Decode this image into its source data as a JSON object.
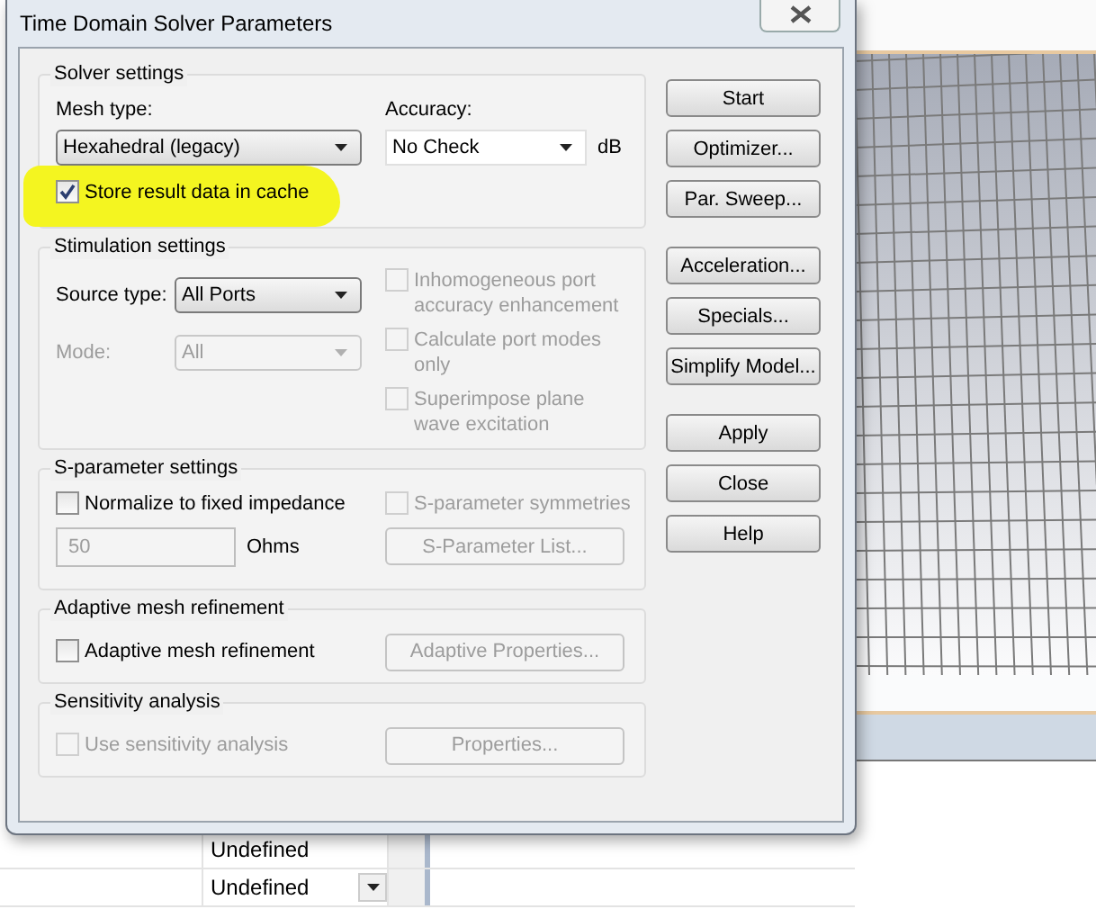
{
  "window": {
    "title": "Time Domain Solver Parameters"
  },
  "solver_settings": {
    "title": "Solver settings",
    "mesh_type": {
      "label": "Mesh type:",
      "value": "Hexahedral (legacy)"
    },
    "accuracy": {
      "label": "Accuracy:",
      "value": "No Check",
      "unit": "dB"
    },
    "store_cache": {
      "label": "Store result data in cache",
      "checked": true,
      "disabled": false
    }
  },
  "stimulation_settings": {
    "title": "Stimulation settings",
    "source_type": {
      "label": "Source type:",
      "value": "All Ports",
      "disabled": false
    },
    "mode": {
      "label": "Mode:",
      "value": "All",
      "disabled": true
    },
    "options": [
      {
        "label": "Inhomogeneous port accuracy enhancement",
        "checked": false,
        "disabled": true
      },
      {
        "label": "Calculate port modes only",
        "checked": false,
        "disabled": true
      },
      {
        "label": "Superimpose plane wave excitation",
        "checked": false,
        "disabled": true
      }
    ]
  },
  "s_parameter_settings": {
    "title": "S-parameter settings",
    "normalize": {
      "label": "Normalize to fixed impedance",
      "checked": false,
      "disabled": false
    },
    "symmetries": {
      "label": "S-parameter symmetries",
      "checked": false,
      "disabled": true
    },
    "impedance": {
      "value": "50",
      "unit": "Ohms",
      "disabled": true
    },
    "list_button": {
      "label": "S-Parameter List...",
      "disabled": true
    }
  },
  "adaptive_mesh_refinement": {
    "title": "Adaptive mesh refinement",
    "checkbox": {
      "label": "Adaptive mesh refinement",
      "checked": false,
      "disabled": false
    },
    "button": {
      "label": "Adaptive Properties...",
      "disabled": true
    }
  },
  "sensitivity_analysis": {
    "title": "Sensitivity analysis",
    "checkbox": {
      "label": "Use sensitivity analysis",
      "checked": false,
      "disabled": true
    },
    "button": {
      "label": "Properties...",
      "disabled": true
    }
  },
  "button_groups": [
    [
      {
        "label": "Start"
      },
      {
        "label": "Optimizer..."
      },
      {
        "label": "Par. Sweep..."
      }
    ],
    [
      {
        "label": "Acceleration..."
      },
      {
        "label": "Specials..."
      },
      {
        "label": "Simplify Model..."
      }
    ],
    [
      {
        "label": "Apply"
      },
      {
        "label": "Close"
      },
      {
        "label": "Help"
      }
    ]
  ],
  "background_table": {
    "cells": [
      {
        "text": "Undefined",
        "dropdown": false
      },
      {
        "text": "Undefined",
        "dropdown": true
      }
    ]
  }
}
